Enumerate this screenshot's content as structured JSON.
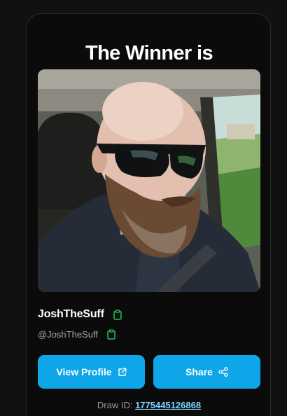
{
  "card": {
    "title": "The Winner is"
  },
  "winner": {
    "name": "JoshTheSuff",
    "handle": "@JoshTheSuff",
    "photo_alt": "JoshTheSuff profile photo"
  },
  "actions": {
    "view_profile_label": "View Profile",
    "view_profile_icon": "external-link-icon",
    "share_label": "Share",
    "share_icon": "share-icon"
  },
  "draw": {
    "label": "Draw ID:",
    "id": "1775445126868"
  },
  "colors": {
    "background": "#111111",
    "card": "#0b0b0b",
    "accent": "#0ea5e9",
    "copy_icon": "#22c55e",
    "link": "#7dd3fc"
  }
}
